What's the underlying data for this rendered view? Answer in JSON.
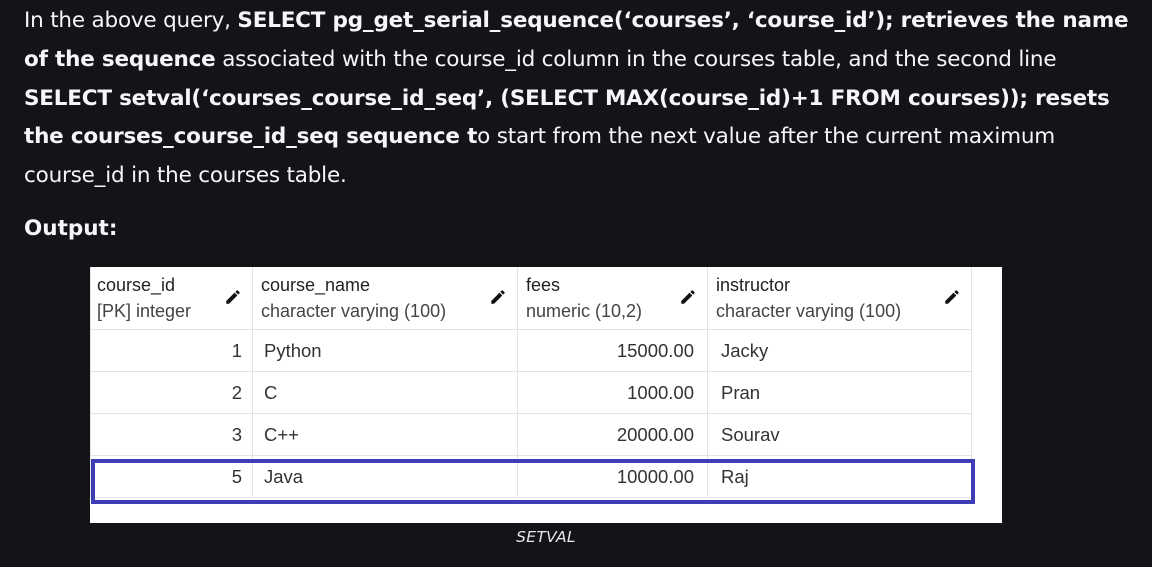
{
  "paragraph": {
    "s1": "In the above query, ",
    "b1": "SELECT pg_get_serial_sequence(‘courses’, ‘course_id’); retrieves the name of the sequence",
    "s2": " associated with the course_id column in the courses table, and the second line ",
    "b2": "SELECT setval(‘courses_course_id_seq’, (SELECT MAX(course_id)+1 FROM courses)); resets the courses_course_id_seq sequence t",
    "s3": "o start from the next value after the current maximum course_id in the courses table."
  },
  "output_label": "Output:",
  "table": {
    "columns": [
      {
        "name": "course_id",
        "type": "[PK] integer",
        "icon": "pencil-icon"
      },
      {
        "name": "course_name",
        "type": "character varying (100)",
        "icon": "pencil-icon"
      },
      {
        "name": "fees",
        "type": "numeric (10,2)",
        "icon": "pencil-icon"
      },
      {
        "name": "instructor",
        "type": "character varying (100)",
        "icon": "pencil-icon"
      }
    ],
    "rows": [
      {
        "course_id": "1",
        "course_name": "Python",
        "fees": "15000.00",
        "instructor": "Jacky"
      },
      {
        "course_id": "2",
        "course_name": "C",
        "fees": "1000.00",
        "instructor": "Pran"
      },
      {
        "course_id": "3",
        "course_name": "C++",
        "fees": "20000.00",
        "instructor": "Sourav"
      },
      {
        "course_id": "5",
        "course_name": "Java",
        "fees": "10000.00",
        "instructor": "Raj"
      }
    ],
    "highlighted_row": 3,
    "highlight_color": "#3f3db5"
  },
  "caption": "SETVAL"
}
